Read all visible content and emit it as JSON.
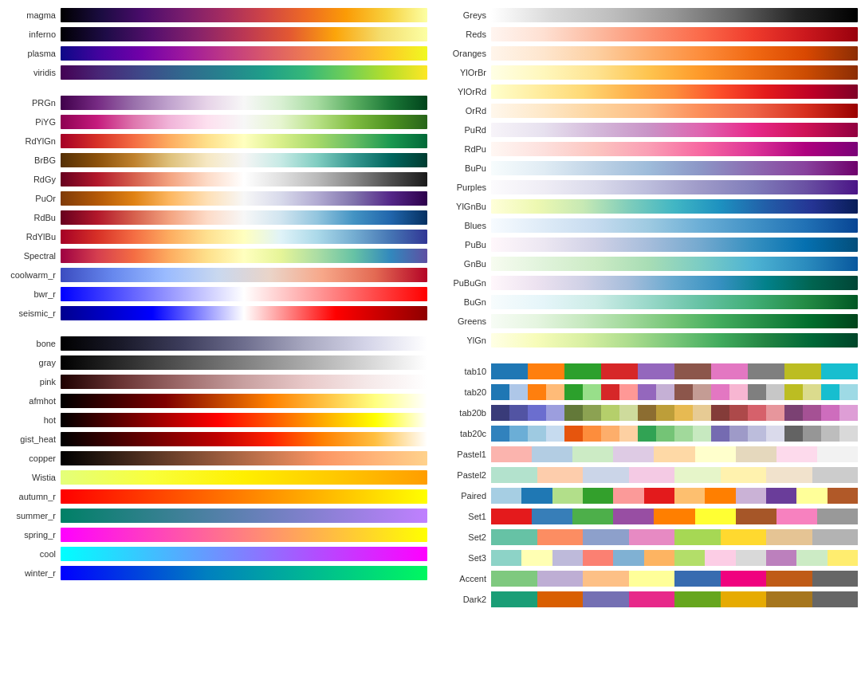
{
  "left_panel": {
    "sequential1": [
      {
        "name": "magma",
        "gradient": "linear-gradient(to right, #000000, #1b0c41, #4a0c6b, #781c6d, #a52c60, #cf4446, #ed6925, #fb9b06, #f7d13d, #fcffa4)"
      },
      {
        "name": "inferno",
        "gradient": "linear-gradient(to right, #000004, #1f0c48, #550f6d, #88226a, #bb3754, #e35832, #fca50a, #f4de6f, #fcffa4)"
      },
      {
        "name": "plasma",
        "gradient": "linear-gradient(to right, #0d0887, #46039f, #7201a8, #9c179e, #bd3786, #d8576b, #ed7953, #fb9f3a, #fdca26, #f0f921)"
      },
      {
        "name": "viridis",
        "gradient": "linear-gradient(to right, #440154, #482878, #3e4989, #31688e, #26828e, #1f9e89, #35b779, #6ece58, #b5de2b, #fde725)"
      }
    ],
    "diverging": [
      {
        "name": "PRGn",
        "gradient": "linear-gradient(to right, #40004b, #762a83, #9970ab, #c2a5cf, #e7d4e8, #f7f7f7, #d9f0d3, #a6dba0, #5aae61, #1b7837, #00441b)"
      },
      {
        "name": "PiYG",
        "gradient": "linear-gradient(to right, #8e0152, #c51b7d, #de77ae, #f1b6da, #fde0ef, #f7f7f7, #e6f5d0, #b8e186, #7fbc41, #4d9221, #276419)"
      },
      {
        "name": "RdYlGn",
        "gradient": "linear-gradient(to right, #a50026, #d73027, #f46d43, #fdae61, #fee08b, #ffffbf, #d9ef8b, #a6d96a, #66bd63, #1a9850, #006837)"
      },
      {
        "name": "BrBG",
        "gradient": "linear-gradient(to right, #543005, #8c510a, #bf812d, #dfc27d, #f6e8c3, #f5f5f5, #c7eae5, #80cdc1, #35978f, #01665e, #003c30)"
      },
      {
        "name": "RdGy",
        "gradient": "linear-gradient(to right, #67001f, #b2182b, #d6604d, #f4a582, #fddbc7, #ffffff, #e0e0e0, #bababa, #878787, #4d4d4d, #1a1a1a)"
      },
      {
        "name": "PuOr",
        "gradient": "linear-gradient(to right, #7f3b08, #b35806, #e08214, #fdb863, #fee0b6, #f7f7f7, #d8daeb, #b2abd2, #8073ac, #542788, #2d004b)"
      },
      {
        "name": "RdBu",
        "gradient": "linear-gradient(to right, #67001f, #b2182b, #d6604d, #f4a582, #fddbc7, #f7f7f7, #d1e5f0, #92c5de, #4393c3, #2166ac, #053061)"
      },
      {
        "name": "RdYlBu",
        "gradient": "linear-gradient(to right, #a50026, #d73027, #f46d43, #fdae61, #fee090, #ffffbf, #e0f3f8, #abd9e9, #74add1, #4575b4, #313695)"
      },
      {
        "name": "Spectral",
        "gradient": "linear-gradient(to right, #9e0142, #d53e4f, #f46d43, #fdae61, #fee08b, #ffffbf, #e6f598, #abdda4, #66c2a5, #3288bd, #5e4fa2)"
      },
      {
        "name": "coolwarm_r",
        "gradient": "linear-gradient(to right, #3b4cc0, #6788ee, #9abbff, #c9d8ef, #ead4c8, #f7a789, #e36a53, #b40426)"
      },
      {
        "name": "bwr_r",
        "gradient": "linear-gradient(to right, #0000ff, #7f7fff, #ffffff, #ff7f7f, #ff0000)"
      },
      {
        "name": "seismic_r",
        "gradient": "linear-gradient(to right, #00008f, #0000ff, #ffffff, #ff0000, #8f0000)"
      }
    ],
    "misc": [
      {
        "name": "bone",
        "gradient": "linear-gradient(to right, #000000, #1a1a2a, #3d3d5c, #6e6e8e, #a8a8c0, #d4d4e8, #ffffff)"
      },
      {
        "name": "gray",
        "gradient": "linear-gradient(to right, #000000, #404040, #808080, #bfbfbf, #ffffff)"
      },
      {
        "name": "pink",
        "gradient": "linear-gradient(to right, #1e0000, #6b3535, #9e6b6b, #c8a0a0, #e8c8c8, #f5e8e8, #ffffff)"
      },
      {
        "name": "afmhot",
        "gradient": "linear-gradient(to right, #000000, #400000, #7f0000, #bf4000, #ff8000, #ffbf40, #ffff80, #ffffff)"
      },
      {
        "name": "hot",
        "gradient": "linear-gradient(to right, #000000, #550000, #aa0000, #ff0000, #ff5500, #ffaa00, #ffff00, #ffffff)"
      },
      {
        "name": "gist_heat",
        "gradient": "linear-gradient(to right, #000000, #400000, #800000, #bf0000, #ff2000, #ff8000, #ffbf40, #ffffff)"
      },
      {
        "name": "copper",
        "gradient": "linear-gradient(to right, #000000, #321e14, #653c28, #975a3c, #c97850, #fb9664, #ffb478, #ffd28c)"
      },
      {
        "name": "Wistia",
        "gradient": "linear-gradient(to right, #e4ff7a, #f9ff3a, #ffef00, #ffc800, #ff9d00)"
      },
      {
        "name": "autumn_r",
        "gradient": "linear-gradient(to right, #ff0000, #ff4000, #ff8000, #ffbf00, #ffff00)"
      },
      {
        "name": "summer_r",
        "gradient": "linear-gradient(to right, #008066, #208080, #408099, #6080b3, #8080cc, #a080e6, #c080ff)"
      },
      {
        "name": "spring_r",
        "gradient": "linear-gradient(to right, #ff00ff, #ff40bf, #ff8080, #ffbf40, #ffff00)"
      },
      {
        "name": "cool",
        "gradient": "linear-gradient(to right, #00ffff, #40bfff, #8080ff, #bf40ff, #ff00ff)"
      },
      {
        "name": "winter_r",
        "gradient": "linear-gradient(to right, #0000ff, #0040df, #0080bf, #00a89f, #00d080, #00f860)"
      }
    ]
  },
  "right_panel": {
    "sequential_single": [
      {
        "name": "Greys",
        "gradient": "linear-gradient(to right, #ffffff, #d9d9d9, #bdbdbd, #969696, #636363, #252525, #000000)"
      },
      {
        "name": "Reds",
        "gradient": "linear-gradient(to right, #fff5f0, #fee0d2, #fcbba1, #fc9272, #fb6a4a, #ef3b2c, #cb181d, #99000d)"
      },
      {
        "name": "Oranges",
        "gradient": "linear-gradient(to right, #fff5eb, #fee6ce, #fdd0a2, #fdae6b, #fd8d3c, #f16913, #d94801, #8c2d04)"
      },
      {
        "name": "YlOrBr",
        "gradient": "linear-gradient(to right, #ffffe5, #fff7bc, #fee391, #fec44f, #fe9929, #ec7014, #cc4c02, #8c2d04)"
      },
      {
        "name": "YlOrRd",
        "gradient": "linear-gradient(to right, #ffffcc, #ffeda0, #fed976, #feb24c, #fd8d3c, #fc4e2a, #e31a1c, #bd0026, #800026)"
      },
      {
        "name": "OrRd",
        "gradient": "linear-gradient(to right, #fff7ec, #fee8c8, #fdd49e, #fdbb84, #fc8d59, #ef6548, #d7301f, #990000)"
      },
      {
        "name": "PuRd",
        "gradient": "linear-gradient(to right, #f7f4f9, #e7e1ef, #d4b9da, #c994c7, #df65b0, #e7298a, #ce1256, #91003f)"
      },
      {
        "name": "RdPu",
        "gradient": "linear-gradient(to right, #fff7f3, #fde0dd, #fcc5c0, #fa9fb5, #f768a1, #dd3497, #ae017e, #7a0177)"
      },
      {
        "name": "BuPu",
        "gradient": "linear-gradient(to right, #f7fcfd, #e0ecf4, #bfd3e6, #9ebcda, #8c96c6, #8c6bb1, #88419d, #6e016b)"
      },
      {
        "name": "Purples",
        "gradient": "linear-gradient(to right, #fcfbfd, #efedf5, #dadaeb, #bcbddc, #9e9ac8, #807dba, #6a51a3, #4a1486)"
      },
      {
        "name": "YlGnBu",
        "gradient": "linear-gradient(to right, #ffffd9, #edf8b1, #c7e9b4, #7fcdbb, #41b6c4, #1d91c0, #225ea8, #253494, #081d58)"
      },
      {
        "name": "Blues",
        "gradient": "linear-gradient(to right, #f7fbff, #deebf7, #c6dbef, #9ecae1, #6baed6, #4292c6, #2171b5, #084594)"
      },
      {
        "name": "PuBu",
        "gradient": "linear-gradient(to right, #fff7fb, #ece7f2, #d0d1e6, #a6bddb, #74a9cf, #3690c0, #0570b0, #034e7b)"
      },
      {
        "name": "GnBu",
        "gradient": "linear-gradient(to right, #f7fcf0, #e0f3db, #ccebc5, #a8ddb5, #7bccc4, #4eb3d3, #2b8cbe, #08589e)"
      },
      {
        "name": "PuBuGn",
        "gradient": "linear-gradient(to right, #fff7fb, #ece2f0, #d0d1e6, #a6bddb, #67a9cf, #3690c0, #02818a, #016450, #014636)"
      },
      {
        "name": "BuGn",
        "gradient": "linear-gradient(to right, #f7fcfd, #e5f5f9, #ccece6, #99d8c9, #66c2a4, #41ae76, #238b45, #005824)"
      },
      {
        "name": "Greens",
        "gradient": "linear-gradient(to right, #f7fcf5, #e5f5e0, #c7e9c0, #a1d99b, #74c476, #41ab5d, #238b45, #006d2c, #00441b)"
      },
      {
        "name": "YlGn",
        "gradient": "linear-gradient(to right, #ffffe5, #f7fcb9, #d9f0a3, #addd8e, #78c679, #41ab5d, #238443, #006837, #004529)"
      }
    ],
    "qualitative": [
      {
        "name": "tab10",
        "colors": [
          "#1f77b4",
          "#ff7f0e",
          "#2ca02c",
          "#d62728",
          "#9467bd",
          "#8c564b",
          "#e377c2",
          "#7f7f7f",
          "#bcbd22",
          "#17becf"
        ]
      },
      {
        "name": "tab20",
        "colors": [
          "#1f77b4",
          "#aec7e8",
          "#ff7f0e",
          "#ffbb78",
          "#2ca02c",
          "#98df8a",
          "#d62728",
          "#ff9896",
          "#9467bd",
          "#c5b0d5",
          "#8c564b",
          "#c49c94",
          "#e377c2",
          "#f7b6d2",
          "#7f7f7f",
          "#c7c7c7",
          "#bcbd22",
          "#dbdb8d",
          "#17becf",
          "#9edae5"
        ]
      },
      {
        "name": "tab20b",
        "colors": [
          "#393b79",
          "#5254a3",
          "#6b6ecf",
          "#9c9ede",
          "#637939",
          "#8ca252",
          "#b5cf6b",
          "#cedb9c",
          "#8c6d31",
          "#bd9e39",
          "#e7ba52",
          "#e7cb94",
          "#843c39",
          "#ad494a",
          "#d6616b",
          "#e7969c",
          "#7b4173",
          "#a55194",
          "#ce6dbd",
          "#de9ed6"
        ]
      },
      {
        "name": "tab20c",
        "colors": [
          "#3182bd",
          "#6baed6",
          "#9ecae1",
          "#c6dbef",
          "#e6550d",
          "#fd8d3c",
          "#fdae6b",
          "#fdd0a2",
          "#31a354",
          "#74c476",
          "#a1d99b",
          "#c7e9c0",
          "#756bb1",
          "#9e9ac8",
          "#bcbddc",
          "#dadaeb",
          "#636363",
          "#969696",
          "#bdbdbd",
          "#d9d9d9"
        ]
      },
      {
        "name": "Pastel1",
        "colors": [
          "#fbb4ae",
          "#b3cde3",
          "#ccebc5",
          "#decbe4",
          "#fed9a6",
          "#ffffcc",
          "#e5d8bd",
          "#fddaec",
          "#f2f2f2"
        ]
      },
      {
        "name": "Pastel2",
        "colors": [
          "#b3e2cd",
          "#fdcdac",
          "#cbd5e8",
          "#f4cae4",
          "#e6f5c9",
          "#fff2ae",
          "#f1e2cc",
          "#cccccc"
        ]
      },
      {
        "name": "Paired",
        "colors": [
          "#a6cee3",
          "#1f78b4",
          "#b2df8a",
          "#33a02c",
          "#fb9a99",
          "#e31a1c",
          "#fdbf6f",
          "#ff7f00",
          "#cab2d6",
          "#6a3d9a",
          "#ffff99",
          "#b15928"
        ]
      },
      {
        "name": "Set1",
        "colors": [
          "#e41a1c",
          "#377eb8",
          "#4daf4a",
          "#984ea3",
          "#ff7f00",
          "#ffff33",
          "#a65628",
          "#f781bf",
          "#999999"
        ]
      },
      {
        "name": "Set2",
        "colors": [
          "#66c2a5",
          "#fc8d62",
          "#8da0cb",
          "#e78ac3",
          "#a6d854",
          "#ffd92f",
          "#e5c494",
          "#b3b3b3"
        ]
      },
      {
        "name": "Set3",
        "colors": [
          "#8dd3c7",
          "#ffffb3",
          "#bebada",
          "#fb8072",
          "#80b1d3",
          "#fdb462",
          "#b3de69",
          "#fccde5",
          "#d9d9d9",
          "#bc80bd",
          "#ccebc5",
          "#ffed6f"
        ]
      },
      {
        "name": "Accent",
        "colors": [
          "#7fc97f",
          "#beaed4",
          "#fdc086",
          "#ffff99",
          "#386cb0",
          "#f0027f",
          "#bf5b17",
          "#666666"
        ]
      },
      {
        "name": "Dark2",
        "colors": [
          "#1b9e77",
          "#d95f02",
          "#7570b3",
          "#e7298a",
          "#66a61e",
          "#e6ab02",
          "#a6761d",
          "#666666"
        ]
      }
    ]
  }
}
